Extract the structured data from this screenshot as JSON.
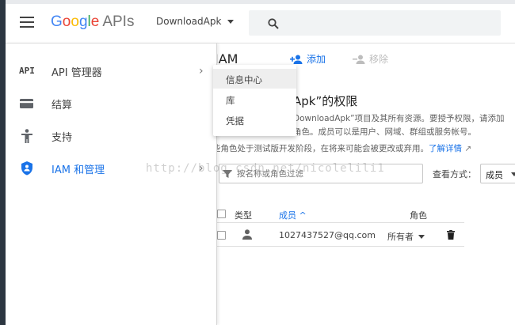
{
  "header": {
    "logo": {
      "google": "Google",
      "apis": "APIs",
      "colors": [
        "#4285F4",
        "#EA4335",
        "#FBBC05",
        "#4285F4",
        "#34A853",
        "#EA4335"
      ]
    },
    "project": "DownloadApk",
    "menu_icon": "hamburger-icon",
    "search_icon": "search-icon"
  },
  "sidebar": {
    "items": [
      {
        "icon_text": "API",
        "label": "API 管理器",
        "icon": "api-icon",
        "has_chevron": true
      },
      {
        "label": "结算",
        "icon": "billing-icon"
      },
      {
        "label": "支持",
        "icon": "support-icon"
      },
      {
        "label": "IAM 和管理",
        "icon": "shield-icon",
        "active": true,
        "has_chevron": true
      }
    ],
    "chevron": "›"
  },
  "dropdown": {
    "items": [
      "信息中心",
      "库",
      "凭据"
    ]
  },
  "main": {
    "title": "IAM",
    "add_label": "添加",
    "remove_label": "移除",
    "permissions_title": "Apk”的权限",
    "desc_line1": "DownloadApk”项目及其所有资源。要授予权限，请添加",
    "desc_line2": "角色。成员可以是用户、网域、群组或服务帐号。",
    "desc_line3": "些角色处于测试版开发阶段，在将来可能会被更改或弃用。",
    "learn_more": "了解详情",
    "filter_placeholder": "按名称或角色过滤",
    "view_by_label": "查看方式：",
    "view_by_value": "成员",
    "table": {
      "headers": {
        "type": "类型",
        "member": "成员 ^",
        "role": "角色"
      },
      "rows": [
        {
          "member": "1027437527@qq.com",
          "role": "所有者",
          "type_icon": "person-icon"
        }
      ]
    }
  },
  "watermark": "http://blog.csdn.net/nicolelili1",
  "colors": {
    "accent": "#1a73e8",
    "drawer_strip": "#2c3641"
  }
}
